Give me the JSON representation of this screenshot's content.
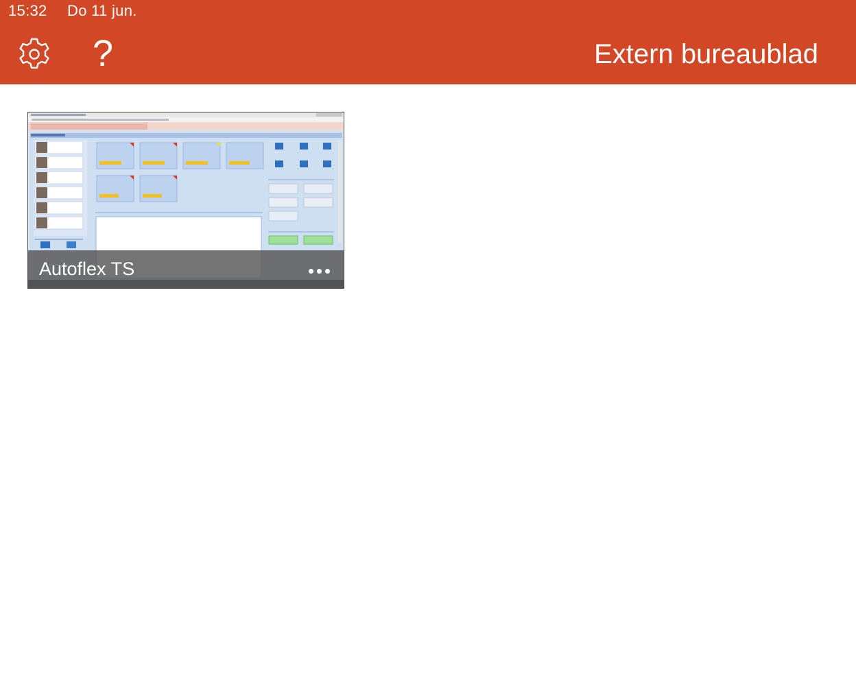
{
  "status_bar": {
    "time": "15:32",
    "date": "Do 11 jun."
  },
  "header": {
    "title": "Extern bureaublad",
    "help_glyph": "?"
  },
  "icons": {
    "settings": "gear-icon",
    "help": "question-icon",
    "more": "ellipsis-icon"
  },
  "colors": {
    "brand": "#D24726",
    "caption_overlay": "#555555"
  },
  "connections": [
    {
      "label": "Autoflex TS"
    }
  ]
}
